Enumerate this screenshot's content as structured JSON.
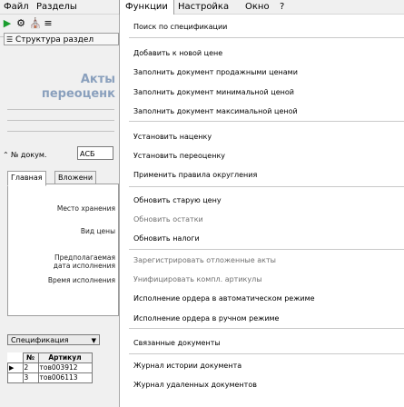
{
  "menubar": {
    "items": [
      "Файл",
      "Разделы",
      "Функции",
      "Настройка",
      "Окно",
      "?"
    ]
  },
  "toolbar": {
    "icons": [
      "green-arrow-icon",
      "settings-icon",
      "building-icon",
      "list-icon"
    ]
  },
  "left_panel": {
    "structure_label": "Структура раздел",
    "title_line1": "Акты",
    "title_line2": "переоценк",
    "doc_number_label": "№ докум.",
    "doc_number_value": "АСБ",
    "tabs": [
      "Главная",
      "Вложени"
    ],
    "fields": [
      "Место хранения",
      "Вид цены",
      "Предполагаемая",
      "дата исполнения",
      "Время исполнения"
    ],
    "spec_button": "Спецификация",
    "grid": {
      "headers": [
        "№",
        "Артикул"
      ],
      "rows": [
        {
          "num": "2",
          "article": "тов003912"
        },
        {
          "num": "3",
          "article": "тов006113"
        }
      ]
    }
  },
  "dropdown": {
    "items": [
      {
        "label": "Поиск по спецификации",
        "enabled": true
      },
      {
        "label": "Добавить к новой цене",
        "enabled": true
      },
      {
        "label": "Заполнить документ продажными ценами",
        "enabled": true
      },
      {
        "label": "Заполнить документ минимальной ценой",
        "enabled": true
      },
      {
        "label": "Заполнить документ максимальной ценой",
        "enabled": true
      },
      {
        "label": "Установить наценку",
        "enabled": true
      },
      {
        "label": "Установить переоценку",
        "enabled": true
      },
      {
        "label": "Применить правила округления",
        "enabled": true
      },
      {
        "label": "Обновить старую цену",
        "enabled": true
      },
      {
        "label": "Обновить остатки",
        "enabled": false
      },
      {
        "label": "Обновить налоги",
        "enabled": true
      },
      {
        "label": "Зарегистрировать отложенные акты",
        "enabled": false
      },
      {
        "label": "Унифицировать компл. артикулы",
        "enabled": false
      },
      {
        "label": "Исполнение ордера в автоматическом режиме",
        "enabled": true
      },
      {
        "label": "Исполнение ордера в ручном режиме",
        "enabled": true
      },
      {
        "label": "Связанные документы",
        "enabled": true
      },
      {
        "label": "Журнал истории документа",
        "enabled": true
      },
      {
        "label": "Журнал удаленных документов",
        "enabled": true
      }
    ]
  }
}
